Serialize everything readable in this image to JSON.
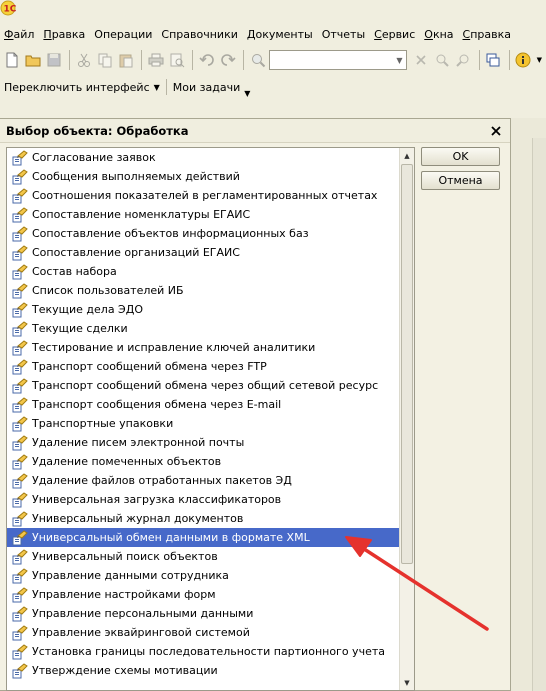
{
  "menu": {
    "items": [
      {
        "accel": "Ф",
        "rest": "айл"
      },
      {
        "accel": "П",
        "rest": "равка"
      },
      {
        "accel": "",
        "rest": "Операции"
      },
      {
        "accel": "",
        "rest": "Справочники"
      },
      {
        "accel": "",
        "rest": "Документы"
      },
      {
        "accel": "",
        "rest": "Отчеты"
      },
      {
        "accel": "С",
        "rest": "ервис"
      },
      {
        "accel": "О",
        "rest": "кна"
      },
      {
        "accel": "С",
        "rest": "правка"
      }
    ]
  },
  "toolbar": {
    "icons": [
      "new-document-icon",
      "open-folder-icon",
      "save-icon",
      "cut-icon",
      "copy-icon",
      "paste-icon",
      "print-icon",
      "print-preview-icon",
      "undo-icon",
      "redo-icon",
      "search-icon",
      "search-clear-icon",
      "find-next-icon",
      "find-prev-icon",
      "windows-icon",
      "info-icon"
    ],
    "search_value": ""
  },
  "panel": {
    "switch_interface": "Переключить интерфейс",
    "my_tasks": "Мои задачи"
  },
  "dialog": {
    "title": "Выбор объекта: Обработка",
    "ok": "OK",
    "cancel": "Отмена",
    "items": [
      "Согласование заявок",
      "Сообщения выполняемых действий",
      "Соотношения показателей в регламентированных отчетах",
      "Сопоставление номенклатуры ЕГАИС",
      "Сопоставление объектов информационных баз",
      "Сопоставление организаций ЕГАИС",
      "Состав набора",
      "Список пользователей ИБ",
      "Текущие дела ЭДО",
      "Текущие сделки",
      "Тестирование и исправление ключей аналитики",
      "Транспорт сообщений обмена через FTP",
      "Транспорт сообщений обмена через общий сетевой ресурс",
      "Транспорт сообщения обмена через E-mail",
      "Транспортные упаковки",
      "Удаление писем электронной почты",
      "Удаление помеченных объектов",
      "Удаление файлов отработанных пакетов ЭД",
      "Универсальная загрузка классификаторов",
      "Универсальный журнал документов",
      "Универсальный обмен данными в формате XML",
      "Универсальный поиск объектов",
      "Управление данными сотрудника",
      "Управление настройками форм",
      "Управление персональными данными",
      "Управление эквайринговой системой",
      "Установка границы последовательности партионного учета",
      "Утверждение схемы мотивации"
    ],
    "selected_index": 20
  },
  "colors": {
    "selection": "#4769c9",
    "annotation_arrow": "#e5322d"
  }
}
